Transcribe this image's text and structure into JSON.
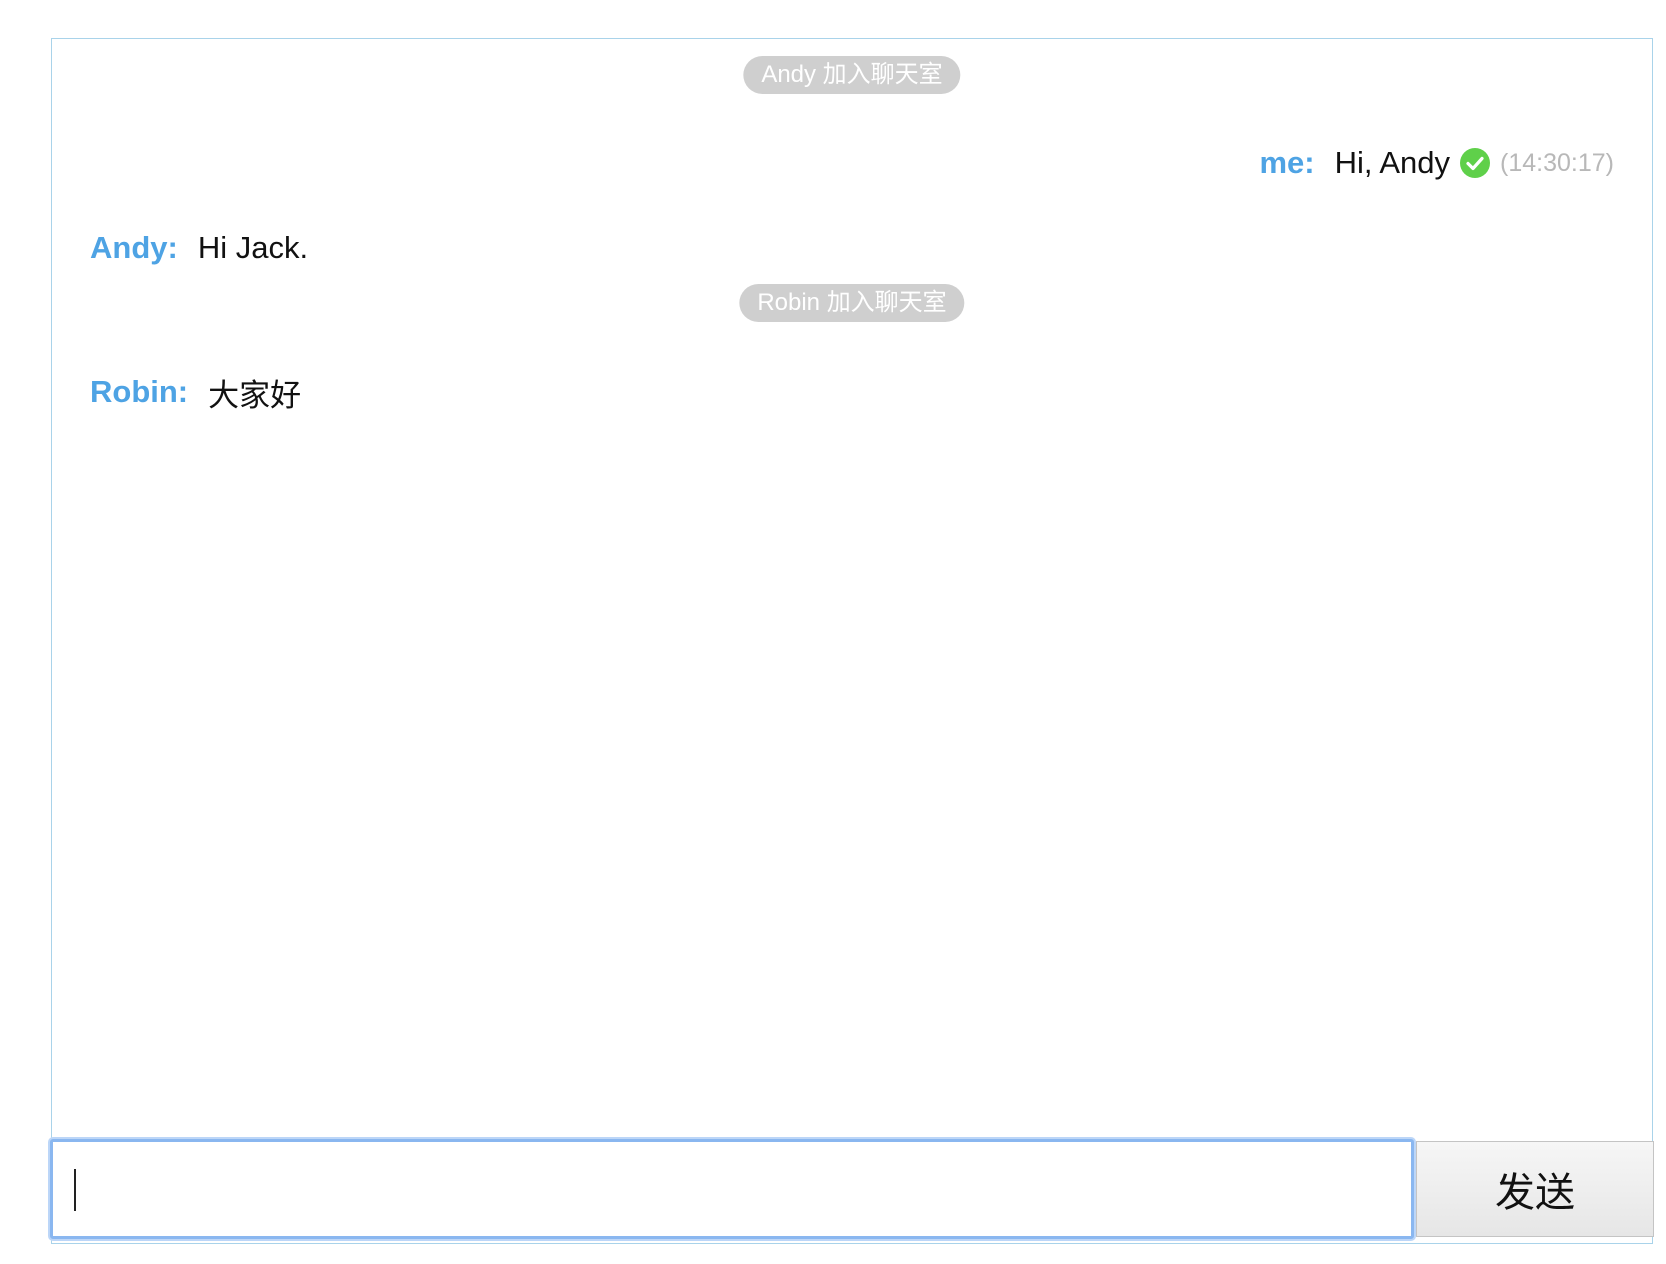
{
  "messages": {
    "system_1": "Andy 加入聊天室",
    "me": {
      "sender": "me:",
      "text": "Hi, Andy",
      "status_icon": "check-circle-icon",
      "timestamp": "(14:30:17)"
    },
    "andy": {
      "sender": "Andy:",
      "text": "Hi Jack."
    },
    "system_2": "Robin 加入聊天室",
    "robin": {
      "sender": "Robin:",
      "text": "大家好"
    }
  },
  "composer": {
    "value": "",
    "send_label": "发送"
  },
  "colors": {
    "sender": "#4ea3e4",
    "system_pill": "#cfcfcf",
    "delivered_check": "#5fd04a",
    "border": "#a9d3ea",
    "input_focus": "#8ab7f0"
  }
}
